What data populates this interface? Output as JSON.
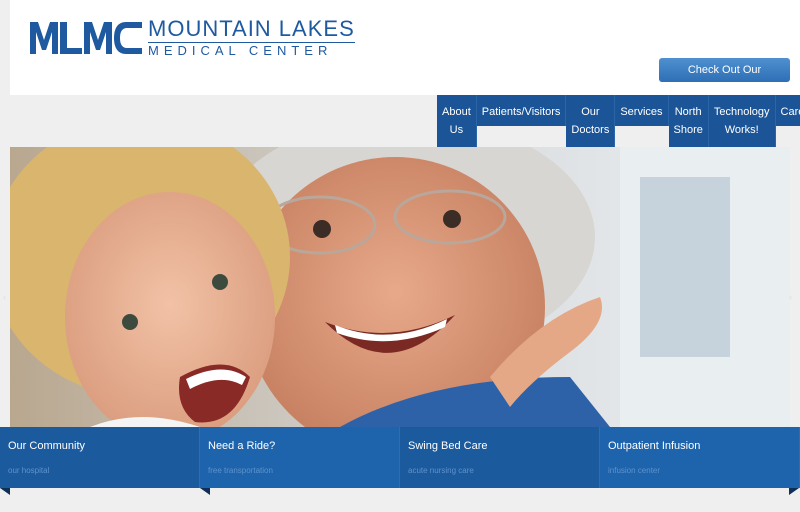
{
  "logo": {
    "mark": "MLMC",
    "name": "MOUNTAIN LAKES",
    "sub": "MEDICAL CENTER"
  },
  "newsletter_label": "Check Out Our Newsletter!",
  "nav": [
    {
      "line1": "About",
      "line2": "Us"
    },
    {
      "line1": "Patients/Visitors",
      "line2": ""
    },
    {
      "line1": "Our",
      "line2": "Doctors"
    },
    {
      "line1": "Services",
      "line2": ""
    },
    {
      "line1": "North",
      "line2": "Shore"
    },
    {
      "line1": "Technology",
      "line2": "Works!"
    },
    {
      "line1": "Careers",
      "line2": ""
    }
  ],
  "boxes": [
    {
      "title": "Our Community",
      "sub": "our hospital"
    },
    {
      "title": "Need a Ride?",
      "sub": "free transportation"
    },
    {
      "title": "Swing Bed Care",
      "sub": "acute nursing care"
    },
    {
      "title": "Outpatient Infusion",
      "sub": "infusion center"
    }
  ],
  "icons": {
    "prev": "chevron-left-icon",
    "next": "chevron-right-icon"
  },
  "colors": {
    "brand_blue": "#1f5aa1",
    "nav_blue": "#1b5597",
    "box_blue": "#1c5a9e",
    "newsletter_blue": "#3a7cc0"
  }
}
